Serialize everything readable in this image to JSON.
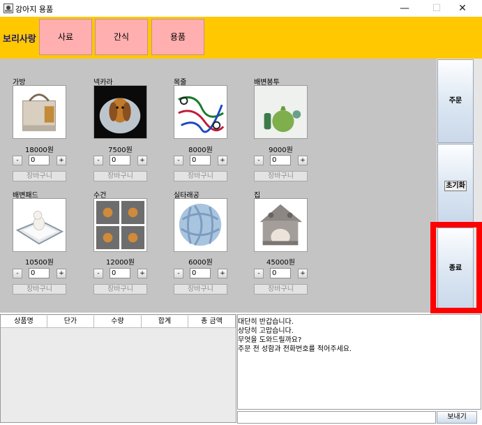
{
  "window": {
    "title": "강아지 용품",
    "minimize_glyph": "—",
    "maximize_glyph": "☐",
    "close_glyph": "✕"
  },
  "header": {
    "brand": "보리사랑",
    "tabs": [
      "사료",
      "간식",
      "용품"
    ],
    "background": "#ffc800",
    "tab_color": "#ffafaf"
  },
  "products": [
    {
      "name": "가방",
      "price": "18000원",
      "qty": "0",
      "icon": "bag-image"
    },
    {
      "name": "넥카라",
      "price": "7500원",
      "qty": "0",
      "icon": "neck-collar-image"
    },
    {
      "name": "목줄",
      "price": "8000원",
      "qty": "0",
      "icon": "leash-image"
    },
    {
      "name": "배변봉투",
      "price": "9000원",
      "qty": "0",
      "icon": "poop-bag-image"
    },
    {
      "name": "배변패드",
      "price": "10500원",
      "qty": "0",
      "icon": "pee-pad-image"
    },
    {
      "name": "수건",
      "price": "12000원",
      "qty": "0",
      "icon": "towel-image"
    },
    {
      "name": "실타래공",
      "price": "6000원",
      "qty": "0",
      "icon": "rope-ball-image"
    },
    {
      "name": "집",
      "price": "45000원",
      "qty": "0",
      "icon": "dog-house-image"
    }
  ],
  "qty_controls": {
    "minus": "-",
    "plus": "+",
    "cart": "장바구니"
  },
  "side_buttons": {
    "order": "주문",
    "reset": "초기화",
    "exit": "종료"
  },
  "table": {
    "columns": [
      "상품명",
      "단가",
      "수량",
      "합계",
      "총 금액"
    ]
  },
  "chat": {
    "lines": [
      "대단히 반갑습니다.",
      "상당히 고맙습니다.",
      "무엇을 도와드릴까요?",
      "주문 전 성함과 전화번호를 적어주세요."
    ],
    "send_label": "보내기"
  }
}
